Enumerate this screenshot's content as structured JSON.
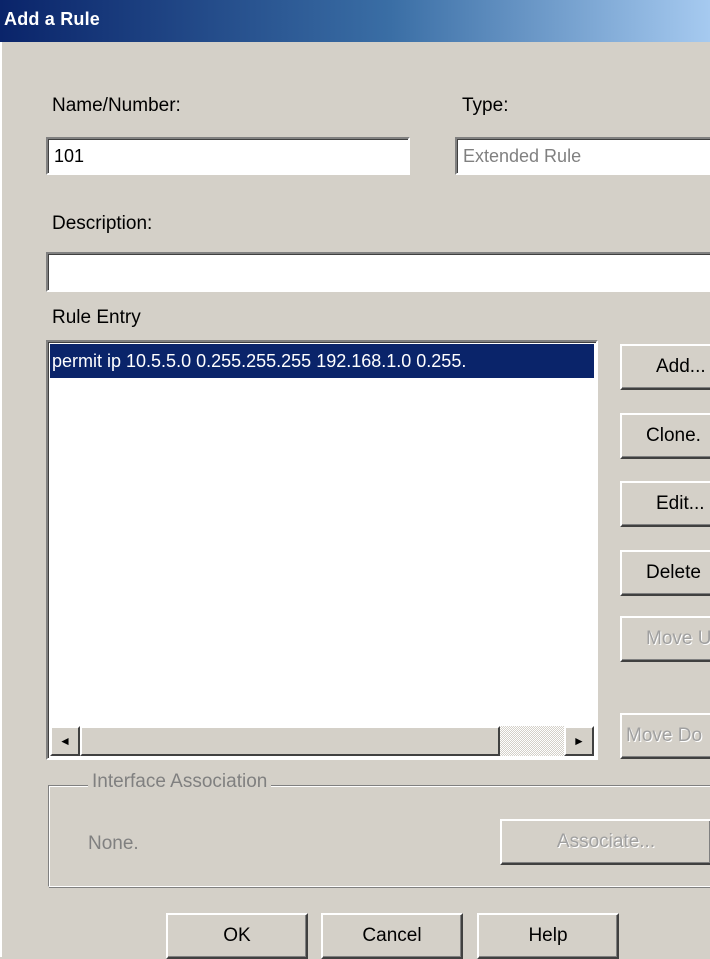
{
  "window": {
    "title": "Add a Rule"
  },
  "form": {
    "name_label": "Name/Number:",
    "name_value": "101",
    "type_label": "Type:",
    "type_value": "Extended Rule",
    "description_label": "Description:",
    "description_value": ""
  },
  "rule_entry": {
    "label": "Rule Entry",
    "items": [
      "permit ip 10.5.5.0 0.255.255.255 192.168.1.0 0.255."
    ]
  },
  "side_buttons": {
    "add": "Add...",
    "clone": "Clone.",
    "edit": "Edit...",
    "delete": "Delete",
    "move_up": "Move U",
    "move_down": "Move Do"
  },
  "interface_association": {
    "legend": "Interface Association",
    "value": "None.",
    "associate": "Associate..."
  },
  "footer": {
    "ok": "OK",
    "cancel": "Cancel",
    "help": "Help"
  },
  "icons": {
    "scroll_left": "◄",
    "scroll_right": "►"
  },
  "colors": {
    "selection": "#0a246a",
    "title_start": "#0a246a",
    "face": "#d4d0c8"
  }
}
